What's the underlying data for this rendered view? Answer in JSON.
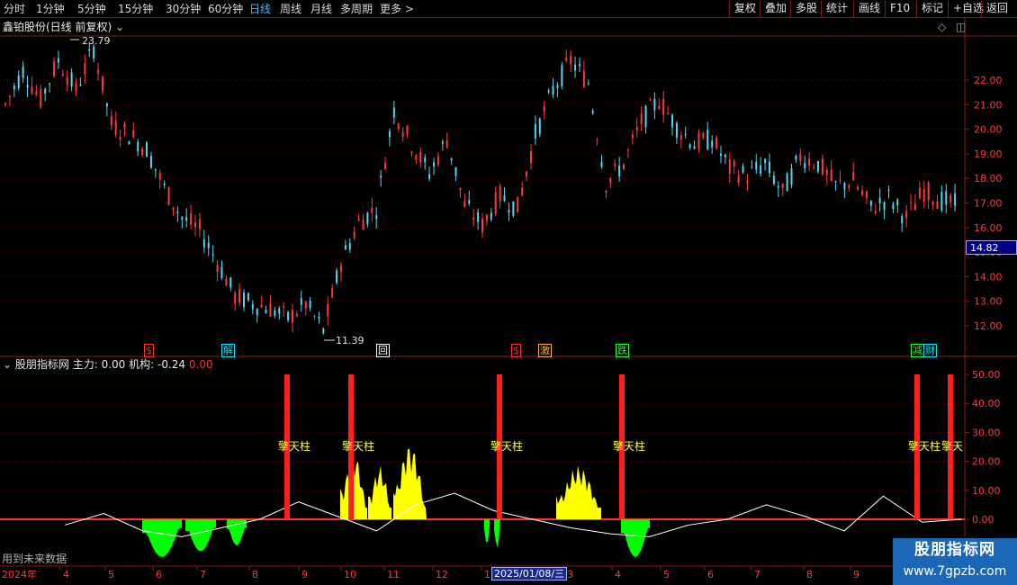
{
  "toolbar": {
    "periods": [
      "分时",
      "1分钟",
      "5分钟",
      "15分钟",
      "30分钟",
      "60分钟",
      "日线",
      "周线",
      "月线",
      "多周期",
      "更多 >"
    ],
    "active_period": "日线",
    "buttons": [
      "复权",
      "叠加",
      "多股",
      "统计",
      "画线",
      "F10",
      "标记",
      "+自选",
      "返回"
    ]
  },
  "main_panel": {
    "title": "鑫铂股份(日线 前复权)",
    "high_label": "23.79",
    "low_label": "11.39",
    "current_price_label": "14.82",
    "signals": [
      {
        "text": "$",
        "color": "#ff3030"
      },
      {
        "text": "解",
        "color": "#00e5ff"
      },
      {
        "text": "回",
        "color": "#ffffff"
      },
      {
        "text": "$",
        "color": "#ff3030"
      },
      {
        "text": "激",
        "color": "#ffb020"
      },
      {
        "text": "跌",
        "color": "#20ff20"
      },
      {
        "text": "减",
        "color": "#20ff20"
      },
      {
        "text": "财",
        "color": "#00e5ff"
      }
    ]
  },
  "sub_panel": {
    "indicator_name": "股朋指标网",
    "main_force_label": "主力: 0.00",
    "institution_label": "机构: -0.24",
    "extra_value": "0.00",
    "pillar_label": "擎天柱",
    "pillar_label_partial": "擎天",
    "note": "用到未来数据"
  },
  "time_axis": {
    "labels": [
      "2024年",
      "4",
      "5",
      "6",
      "7",
      "8",
      "9",
      "10",
      "11",
      "12",
      "1",
      "3",
      "4",
      "5",
      "6",
      "7",
      "8",
      "9"
    ],
    "selected_date": "2025/01/08/三"
  },
  "watermark": {
    "line1": "股朋指标网",
    "line2": "www.7gpzb.com"
  },
  "colors": {
    "up": "#ff3a3a",
    "down": "#54d6f0",
    "pillar": "#ff1e1e",
    "yellow": "#ffff00",
    "green": "#00ff00",
    "line": "#ffffff",
    "axis": "#8b1a1a"
  },
  "chart_data": [
    {
      "type": "candlestick",
      "title": "鑫铂股份(日线 前复权)",
      "ylim": [
        11.0,
        24.0
      ],
      "y_ticks": [
        12.0,
        13.0,
        14.0,
        15.0,
        16.0,
        17.0,
        18.0,
        19.0,
        20.0,
        21.0,
        22.0
      ],
      "x": [
        "2024年",
        "4",
        "5",
        "6",
        "7",
        "8",
        "9",
        "10",
        "11",
        "12",
        "1",
        "3",
        "4",
        "5",
        "6",
        "7",
        "8",
        "9"
      ],
      "series": [
        {
          "name": "",
          "values": [
            21.0,
            22.4,
            21.2,
            22.8,
            21.6,
            23.3,
            20.2,
            19.8,
            19.2,
            17.6,
            16.4,
            15.9,
            14.6,
            13.2,
            12.9,
            12.7,
            12.3,
            12.9,
            11.8,
            14.6,
            16.2,
            16.8,
            20.8,
            19.4,
            18.2,
            19.6,
            16.9,
            16.1,
            17.3,
            16.8,
            19.8,
            21.6,
            22.8,
            21.9,
            17.8,
            18.6,
            20.3,
            21.2,
            20.1,
            19.4,
            19.6,
            18.4,
            18.1,
            18.6,
            17.4,
            18.9,
            18.6,
            17.7,
            17.9,
            16.8,
            17.2,
            16.4,
            17.5,
            17.1,
            16.9
          ]
        }
      ],
      "high": 23.79,
      "low": 11.39,
      "last_price": 14.82
    },
    {
      "type": "bar",
      "title": "股朋指标网",
      "ylim": [
        -15.0,
        55.0
      ],
      "y_ticks": [
        0.0,
        10.0,
        20.0,
        30.0,
        40.0,
        50.0
      ],
      "series": [
        {
          "name": "擎天柱",
          "values": [
            50,
            50,
            50,
            50,
            50,
            50
          ]
        },
        {
          "name": "",
          "values": [
            24,
            20,
            18,
            22,
            28,
            24,
            18,
            17,
            20,
            19,
            17
          ]
        },
        {
          "name": "",
          "values": [
            -11,
            -12,
            -12,
            -11,
            -9,
            -8,
            -6,
            -11,
            -12
          ]
        },
        {
          "name": "",
          "values": [
            -2,
            2,
            -4,
            -6,
            -3,
            0,
            6,
            1,
            -4,
            5,
            9,
            3,
            0,
            -3,
            -5,
            -6,
            -2,
            0,
            5,
            1,
            -4,
            8,
            -1,
            0
          ]
        }
      ]
    }
  ]
}
